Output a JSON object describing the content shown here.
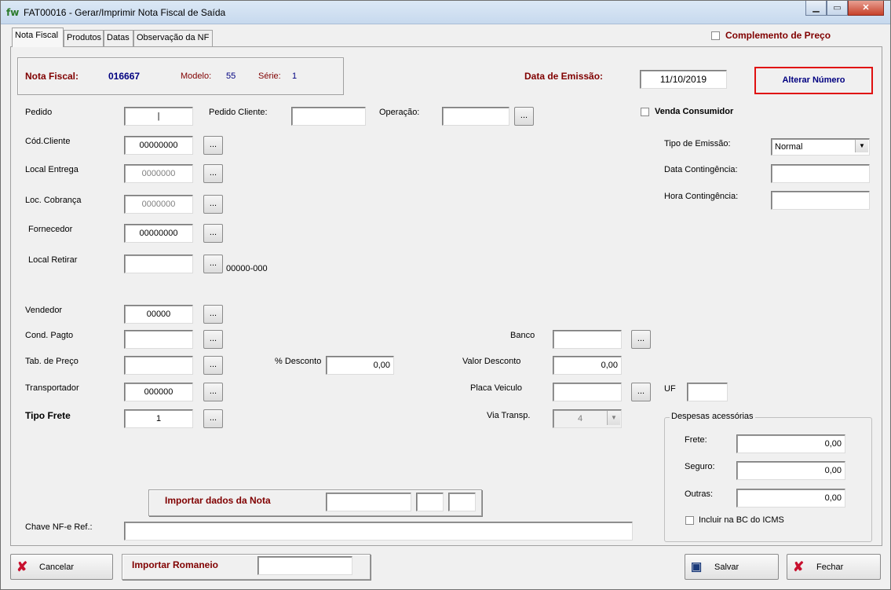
{
  "window": {
    "icon_text": "fw",
    "title": "FAT00016 - Gerar/Imprimir Nota Fiscal de Saída",
    "minimize": "▁",
    "maximize": "▭",
    "close": "✕"
  },
  "tabs": [
    {
      "label": "Nota Fiscal",
      "active": true
    },
    {
      "label": "Produtos"
    },
    {
      "label": "Datas"
    },
    {
      "label": "Observação da NF"
    }
  ],
  "complemento_preco": {
    "label": "Complemento de Preço",
    "checked": false
  },
  "nota_header": {
    "label": "Nota Fiscal:",
    "number": "016667",
    "modelo_label": "Modelo:",
    "modelo": "55",
    "serie_label": "Série:",
    "serie": "1"
  },
  "data_emissao": {
    "label": "Data de Emissão:",
    "value": "11/10/2019"
  },
  "alterar_numero_label": "Alterar Número",
  "venda_consumidor": {
    "label": "Venda Consumidor",
    "checked": false
  },
  "fields": {
    "pedido": {
      "label": "Pedido",
      "value": "|"
    },
    "pedido_cliente": {
      "label": "Pedido Cliente:",
      "value": ""
    },
    "operacao": {
      "label": "Operação:",
      "value": ""
    },
    "cod_cliente": {
      "label": "Cód.Cliente",
      "value": "00000000"
    },
    "local_entrega": {
      "label": "Local Entrega",
      "value": "0000000"
    },
    "loc_cobranca": {
      "label": "Loc. Cobrança",
      "value": "0000000"
    },
    "fornecedor": {
      "label": "Fornecedor",
      "value": "00000000"
    },
    "local_retirar": {
      "label": "Local Retirar",
      "value": "",
      "cep": "00000-000"
    },
    "vendedor": {
      "label": "Vendedor",
      "value": "00000"
    },
    "cond_pagto": {
      "label": "Cond. Pagto",
      "value": ""
    },
    "tab_preco": {
      "label": "Tab. de Preço",
      "value": ""
    },
    "transportador": {
      "label": "Transportador",
      "value": "000000"
    },
    "tipo_frete": {
      "label": "Tipo Frete",
      "value": "1"
    },
    "perc_desconto": {
      "label": "% Desconto",
      "value": "0,00"
    },
    "banco": {
      "label": "Banco",
      "value": ""
    },
    "valor_desconto": {
      "label": "Valor Desconto",
      "value": "0,00"
    },
    "placa_veiculo": {
      "label": "Placa Veiculo",
      "value": ""
    },
    "uf": {
      "label": "UF",
      "value": ""
    },
    "via_transp": {
      "label": "Via Transp.",
      "value": "4"
    },
    "tipo_emissao": {
      "label": "Tipo de Emissão:",
      "value": "Normal"
    },
    "data_contingencia": {
      "label": "Data Contingência:",
      "value": ""
    },
    "hora_contingencia": {
      "label": "Hora Contingência:",
      "value": ""
    },
    "chave_nfe_ref": {
      "label": "Chave NF-e Ref.:",
      "value": ""
    }
  },
  "ellipsis": "...",
  "despesas": {
    "title": "Despesas acessórias",
    "frete_label": "Frete:",
    "frete": "0,00",
    "seguro_label": "Seguro:",
    "seguro": "0,00",
    "outras_label": "Outras:",
    "outras": "0,00",
    "incluir_bc_label": "Incluir na BC do ICMS",
    "incluir_bc_checked": false
  },
  "importar_nota": {
    "label": "Importar dados da Nota",
    "value1": "",
    "value2": "",
    "value3": ""
  },
  "footer": {
    "cancelar": "Cancelar",
    "importar_romaneio": "Importar Romaneio",
    "romaneio_value": "",
    "salvar": "Salvar",
    "fechar": "Fechar"
  }
}
